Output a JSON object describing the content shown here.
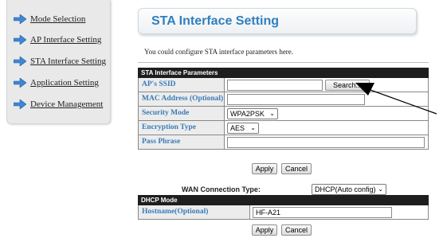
{
  "sidebar": {
    "items": [
      {
        "label": "Mode Selection"
      },
      {
        "label": "AP Interface Setting"
      },
      {
        "label": "STA Interface Setting"
      },
      {
        "label": "Application Setting"
      },
      {
        "label": "Device Management"
      }
    ]
  },
  "header": {
    "title": "STA Interface Setting",
    "intro": "You could configure STA interface parameters here."
  },
  "sta_params": {
    "section_title": "STA Interface Parameters",
    "ssid_label": "AP's SSID",
    "ssid_value": "",
    "search_label": "Search...",
    "mac_label": "MAC Address (Optional)",
    "mac_value": "",
    "security_label": "Security Mode",
    "security_value": "WPA2PSK",
    "encryption_label": "Encryption Type",
    "encryption_value": "AES",
    "pass_label": "Pass Phrase",
    "pass_value": ""
  },
  "actions": {
    "apply": "Apply",
    "cancel": "Cancel"
  },
  "wan": {
    "label": "WAN Connection Type:",
    "value": "DHCP(Auto config)"
  },
  "dhcp": {
    "section_title": "DHCP Mode",
    "hostname_label": "Hostname(Optional)",
    "hostname_value": "HF-A21"
  },
  "icons": {
    "nav_arrow": "arrow-right-icon",
    "dropdown": "chevron-down-icon"
  },
  "colors": {
    "accent": "#2f7fbf",
    "label_text": "#3a7bb8",
    "header_bg": "#1e1e1e",
    "nav_arrow": "#3d86d8"
  }
}
